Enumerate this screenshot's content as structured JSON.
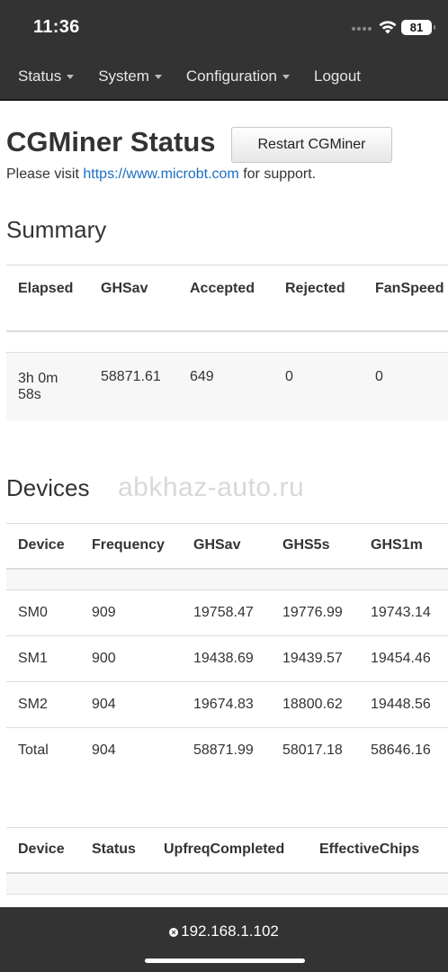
{
  "status_bar": {
    "time": "11:36",
    "battery": "81"
  },
  "nav": {
    "items": [
      {
        "label": "Status",
        "dropdown": true
      },
      {
        "label": "System",
        "dropdown": true
      },
      {
        "label": "Configuration",
        "dropdown": true
      },
      {
        "label": "Logout",
        "dropdown": false
      }
    ]
  },
  "page": {
    "title": "CGMiner Status",
    "restart_button": "Restart CGMiner",
    "support_prefix": "Please visit ",
    "support_link": "https://www.microbt.com",
    "support_suffix": " for support."
  },
  "summary": {
    "title": "Summary",
    "headers": [
      "Elapsed",
      "GHSav",
      "Accepted",
      "Rejected",
      "FanSpeed"
    ],
    "row": {
      "elapsed_line1": "3h 0m",
      "elapsed_line2": "58s",
      "ghsav": "58871.61",
      "accepted": "649",
      "rejected": "0",
      "fanspeed": "0"
    }
  },
  "devices": {
    "title": "Devices",
    "headers": [
      "Device",
      "Frequency",
      "GHSav",
      "GHS5s",
      "GHS1m"
    ],
    "rows": [
      [
        "SM0",
        "909",
        "19758.47",
        "19776.99",
        "19743.14"
      ],
      [
        "SM1",
        "900",
        "19438.69",
        "19439.57",
        "19454.46"
      ],
      [
        "SM2",
        "904",
        "19674.83",
        "18800.62",
        "19448.56"
      ],
      [
        "Total",
        "904",
        "58871.99",
        "58017.18",
        "58646.16"
      ]
    ]
  },
  "device_status": {
    "headers": [
      "Device",
      "Status",
      "UpfreqCompleted",
      "EffectiveChips"
    ]
  },
  "watermark": "abkhaz-auto.ru",
  "address_bar": {
    "url": "192.168.1.102"
  }
}
